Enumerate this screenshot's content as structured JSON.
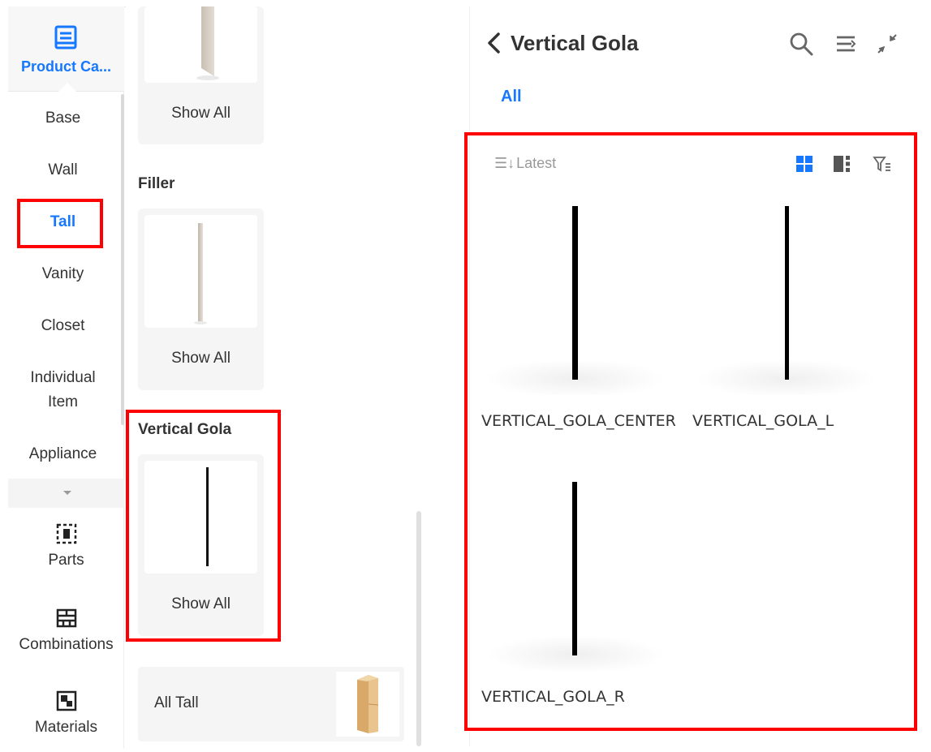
{
  "nav": {
    "header_label": "Product Ca...",
    "categories": [
      "Base",
      "Wall",
      "Tall",
      "Vanity",
      "Closet",
      "Individual Item",
      "Appliance"
    ],
    "categories_line1": "Individual",
    "categories_line2": "Item",
    "active_category": "Tall",
    "tools": [
      {
        "label": "Parts",
        "icon": "parts-icon"
      },
      {
        "label": "Combinations",
        "icon": "combinations-icon"
      },
      {
        "label": "Materials",
        "icon": "materials-icon"
      }
    ]
  },
  "content": {
    "show_all_label": "Show All",
    "sections": [
      {
        "title": "Filler"
      },
      {
        "title": "Vertical Gola"
      }
    ],
    "all_tall_label": "All Tall"
  },
  "detail": {
    "title": "Vertical Gola",
    "tabs": [
      "All"
    ],
    "sort_label": "Latest",
    "products": [
      {
        "name": "VERTICAL_GOLA_CENTER"
      },
      {
        "name": "VERTICAL_GOLA_L"
      },
      {
        "name": "VERTICAL_GOLA_R"
      }
    ]
  },
  "colors": {
    "accent": "#1677ff",
    "highlight": "#ff0000",
    "text": "#333333",
    "muted": "#999999"
  }
}
